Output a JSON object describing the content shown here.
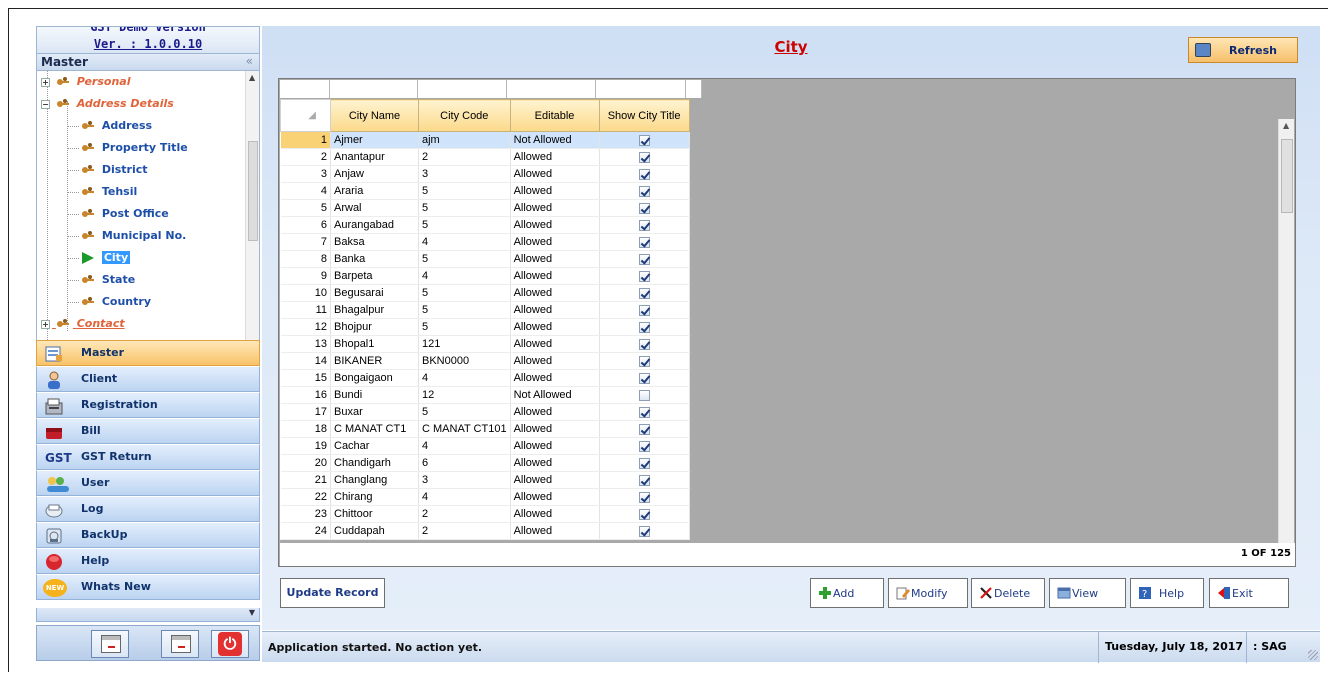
{
  "app": {
    "version_top": "GST Demo Version",
    "version": "Ver. : 1.0.0.10"
  },
  "sidebar": {
    "panel_title": "Master",
    "collapse_glyph": "«",
    "tree": [
      {
        "label": "Personal",
        "type": "category",
        "expanded": false
      },
      {
        "label": "Address Details",
        "type": "category",
        "expanded": true
      },
      {
        "label": "Address",
        "type": "leaf"
      },
      {
        "label": "Property Title",
        "type": "leaf"
      },
      {
        "label": "District",
        "type": "leaf"
      },
      {
        "label": "Tehsil",
        "type": "leaf"
      },
      {
        "label": "Post Office",
        "type": "leaf"
      },
      {
        "label": "Municipal No.",
        "type": "leaf"
      },
      {
        "label": "City",
        "type": "leaf",
        "selected": true
      },
      {
        "label": "State",
        "type": "leaf"
      },
      {
        "label": "Country",
        "type": "leaf"
      },
      {
        "label": "Contact",
        "type": "category",
        "expanded": false
      }
    ],
    "nav": [
      {
        "label": "Master",
        "icon": "master-icon",
        "active": true
      },
      {
        "label": "Client",
        "icon": "client-icon"
      },
      {
        "label": "Registration",
        "icon": "registration-icon"
      },
      {
        "label": "Bill",
        "icon": "bill-icon"
      },
      {
        "label": "GST Return",
        "icon": "gst-icon",
        "icon_text": "GST"
      },
      {
        "label": "User",
        "icon": "user-icon"
      },
      {
        "label": "Log",
        "icon": "log-icon"
      },
      {
        "label": "BackUp",
        "icon": "backup-icon"
      },
      {
        "label": "Help",
        "icon": "help-icon"
      },
      {
        "label": "Whats New",
        "icon": "new-icon",
        "icon_text": "NEW"
      }
    ]
  },
  "main": {
    "title": "City",
    "refresh_label": "Refresh",
    "grid": {
      "columns": [
        "City Name",
        "City Code",
        "Editable",
        "Show City Title"
      ],
      "rows": [
        {
          "n": "1",
          "name": "Ajmer",
          "code": "ajm",
          "editable": "Not Allowed",
          "show": true
        },
        {
          "n": "2",
          "name": "Anantapur",
          "code": "2",
          "editable": "Allowed",
          "show": true
        },
        {
          "n": "3",
          "name": "Anjaw",
          "code": "3",
          "editable": "Allowed",
          "show": true
        },
        {
          "n": "4",
          "name": "Araria",
          "code": "5",
          "editable": "Allowed",
          "show": true
        },
        {
          "n": "5",
          "name": "Arwal",
          "code": "5",
          "editable": "Allowed",
          "show": true
        },
        {
          "n": "6",
          "name": "Aurangabad",
          "code": "5",
          "editable": "Allowed",
          "show": true
        },
        {
          "n": "7",
          "name": "Baksa",
          "code": "4",
          "editable": "Allowed",
          "show": true
        },
        {
          "n": "8",
          "name": "Banka",
          "code": "5",
          "editable": "Allowed",
          "show": true
        },
        {
          "n": "9",
          "name": "Barpeta",
          "code": "4",
          "editable": "Allowed",
          "show": true
        },
        {
          "n": "10",
          "name": "Begusarai",
          "code": "5",
          "editable": "Allowed",
          "show": true
        },
        {
          "n": "11",
          "name": "Bhagalpur",
          "code": "5",
          "editable": "Allowed",
          "show": true
        },
        {
          "n": "12",
          "name": "Bhojpur",
          "code": "5",
          "editable": "Allowed",
          "show": true
        },
        {
          "n": "13",
          "name": "Bhopal1",
          "code": "121",
          "editable": "Allowed",
          "show": true
        },
        {
          "n": "14",
          "name": "BIKANER",
          "code": "BKN0000",
          "editable": "Allowed",
          "show": true
        },
        {
          "n": "15",
          "name": "Bongaigaon",
          "code": "4",
          "editable": "Allowed",
          "show": true
        },
        {
          "n": "16",
          "name": "Bundi",
          "code": "12",
          "editable": "Not Allowed",
          "show": false
        },
        {
          "n": "17",
          "name": "Buxar",
          "code": "5",
          "editable": "Allowed",
          "show": true
        },
        {
          "n": "18",
          "name": "C MANAT CT1",
          "code": "C MANAT CT101",
          "editable": "Allowed",
          "show": true
        },
        {
          "n": "19",
          "name": "Cachar",
          "code": "4",
          "editable": "Allowed",
          "show": true
        },
        {
          "n": "20",
          "name": "Chandigarh",
          "code": "6",
          "editable": "Allowed",
          "show": true
        },
        {
          "n": "21",
          "name": "Changlang",
          "code": "3",
          "editable": "Allowed",
          "show": true
        },
        {
          "n": "22",
          "name": "Chirang",
          "code": "4",
          "editable": "Allowed",
          "show": true
        },
        {
          "n": "23",
          "name": "Chittoor",
          "code": "2",
          "editable": "Allowed",
          "show": true
        },
        {
          "n": "24",
          "name": "Cuddapah",
          "code": "2",
          "editable": "Allowed",
          "show": true
        }
      ],
      "pager": "1 OF 125"
    },
    "update_label": "Update Record",
    "actions": [
      {
        "label": "Add",
        "icon": "add-icon"
      },
      {
        "label": "Modify",
        "icon": "modify-icon"
      },
      {
        "label": "Delete",
        "icon": "delete-icon"
      },
      {
        "label": "View",
        "icon": "view-icon"
      },
      {
        "label": "Help",
        "icon": "help-icon"
      },
      {
        "label": "Exit",
        "icon": "exit-icon"
      }
    ]
  },
  "status": {
    "message": "Application started. No action yet.",
    "date": "Tuesday, July 18, 2017",
    "user": ": SAG"
  }
}
